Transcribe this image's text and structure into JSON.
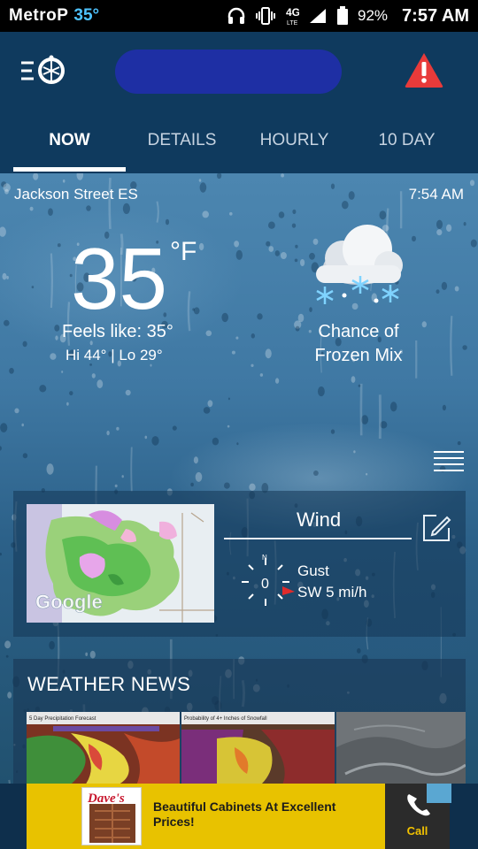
{
  "status_bar": {
    "carrier": "MetroP",
    "temp": "35°",
    "network": "4G LTE",
    "battery": "92%",
    "time": "7:57 AM"
  },
  "header": {
    "tabs": [
      {
        "label": "NOW",
        "active": true
      },
      {
        "label": "DETAILS",
        "active": false
      },
      {
        "label": "HOURLY",
        "active": false
      },
      {
        "label": "10 DAY",
        "active": false
      }
    ]
  },
  "current": {
    "station": "Jackson Street ES",
    "updated": "7:54 AM",
    "temperature": "35",
    "unit": "°F",
    "feels_like": "Feels like: 35°",
    "hi_lo": "Hi  44°  | Lo  29°",
    "condition_line1": "Chance of",
    "condition_line2": "Frozen Mix",
    "condition_icon": "cloud-snow-icon"
  },
  "wind": {
    "title": "Wind",
    "speed": "0",
    "compass_n": "N",
    "gust_label": "Gust",
    "gust_value": "SW 5 mi/h"
  },
  "map": {
    "watermark": "Google"
  },
  "news": {
    "title": "WEATHER NEWS",
    "thumbs": [
      {
        "caption": "5 Day Precipitation Forecast"
      },
      {
        "caption": "Probability of 4+ Inches of Snowfall"
      },
      {
        "caption": ""
      }
    ]
  },
  "ad": {
    "brand": "Dave's",
    "text": "Beautiful Cabinets At Excellent Prices!",
    "call_label": "Call"
  },
  "colors": {
    "header_bg": "#0f3a5e",
    "alert_red": "#e83a3a",
    "ad_yellow": "#e8c200",
    "status_temp": "#4ec3ff"
  }
}
